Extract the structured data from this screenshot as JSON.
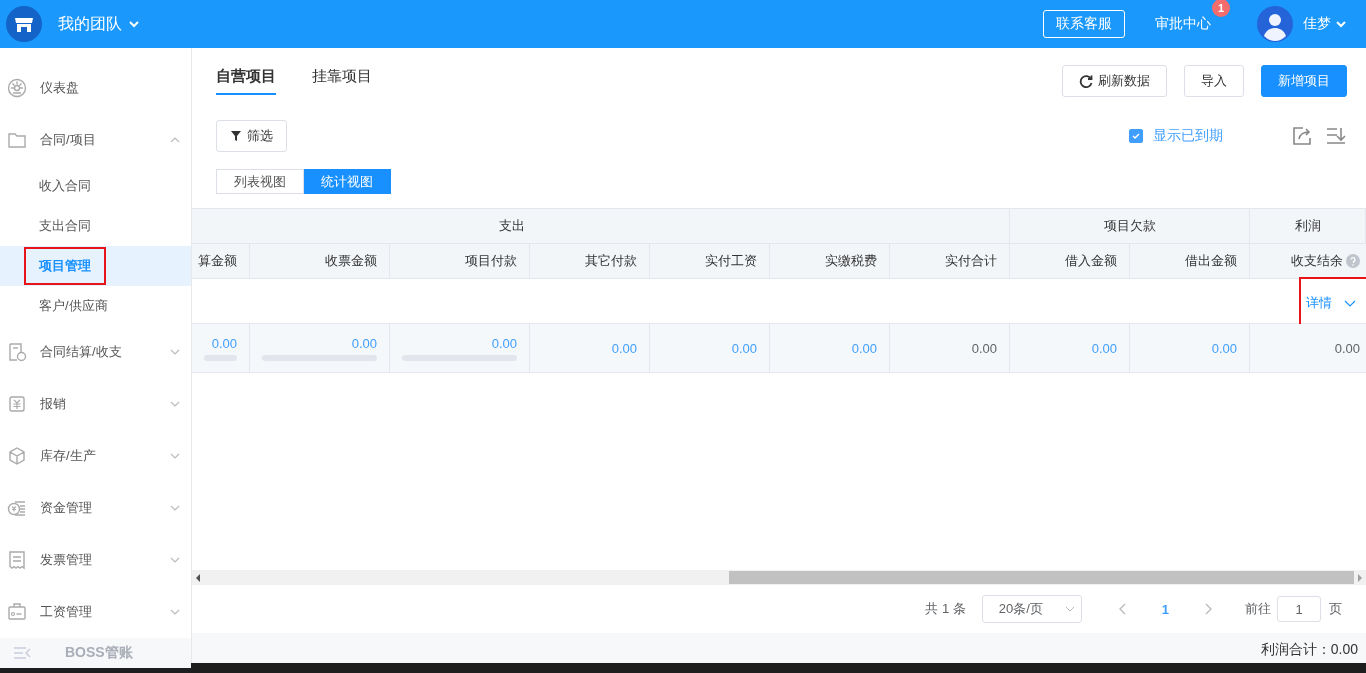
{
  "header": {
    "team": "我的团队",
    "service_button": "联系客服",
    "approval": {
      "label": "审批中心",
      "badge": "1"
    },
    "user": "佳梦"
  },
  "sidebar": {
    "items": [
      {
        "label": "仪表盘",
        "kind": "link"
      },
      {
        "label": "合同/项目",
        "kind": "group",
        "expanded": true,
        "children": [
          {
            "label": "收入合同",
            "selected": false,
            "annotated": false
          },
          {
            "label": "支出合同",
            "selected": false,
            "annotated": false
          },
          {
            "label": "项目管理",
            "selected": true,
            "annotated": true
          },
          {
            "label": "客户/供应商",
            "selected": false,
            "annotated": false
          }
        ]
      },
      {
        "label": "合同结算/收支",
        "kind": "group",
        "expanded": false
      },
      {
        "label": "报销",
        "kind": "group",
        "expanded": false
      },
      {
        "label": "库存/生产",
        "kind": "group",
        "expanded": false
      },
      {
        "label": "资金管理",
        "kind": "group",
        "expanded": false
      },
      {
        "label": "发票管理",
        "kind": "group",
        "expanded": false
      },
      {
        "label": "工资管理",
        "kind": "group",
        "expanded": false
      }
    ],
    "footer": "BOSS管账"
  },
  "tabs": [
    {
      "label": "自营项目",
      "selected": true
    },
    {
      "label": "挂靠项目",
      "selected": false
    }
  ],
  "actions": [
    {
      "label": "刷新数据",
      "kind": "refresh"
    },
    {
      "label": "导入",
      "kind": "default"
    },
    {
      "label": "新增项目",
      "kind": "primary"
    }
  ],
  "filter_button": "筛选",
  "show_expired": {
    "label": "显示已到期",
    "checked": true
  },
  "view_toggle": [
    {
      "label": "列表视图",
      "selected": false
    },
    {
      "label": "统计视图",
      "selected": true
    }
  ],
  "table": {
    "groups": [
      {
        "label": "支出",
        "columns": [
          "算金额",
          "收票金额",
          "项目付款",
          "其它付款",
          "实付工资",
          "实缴税费",
          "实付合计"
        ]
      },
      {
        "label": "项目欠款",
        "columns": [
          "借入金额",
          "借出金额"
        ]
      },
      {
        "label": "利润",
        "columns": [
          "收支结余"
        ]
      }
    ],
    "detail_link": {
      "label": "详情",
      "annotated": true
    },
    "rows": [
      {
        "cells": [
          {
            "text": "0.00",
            "kind": "link",
            "level": 0
          },
          {
            "text": "0.00",
            "kind": "link",
            "level": 0
          },
          {
            "text": "0.00",
            "kind": "link",
            "level": 0
          },
          {
            "text": "0.00",
            "kind": "link"
          },
          {
            "text": "0.00",
            "kind": "link"
          },
          {
            "text": "0.00",
            "kind": "link"
          },
          {
            "text": "0.00",
            "kind": "plain"
          },
          {
            "text": "0.00",
            "kind": "link"
          },
          {
            "text": "0.00",
            "kind": "link"
          },
          {
            "text": "0.00",
            "kind": "plain"
          }
        ]
      }
    ]
  },
  "pagination": {
    "total": "共 1 条",
    "page_size": "20条/页",
    "pages": [
      {
        "label": "1",
        "selected": true
      }
    ],
    "goto_label": "前往",
    "goto_value": "1",
    "goto_unit": "页"
  },
  "footer": "利润合计：0.00"
}
